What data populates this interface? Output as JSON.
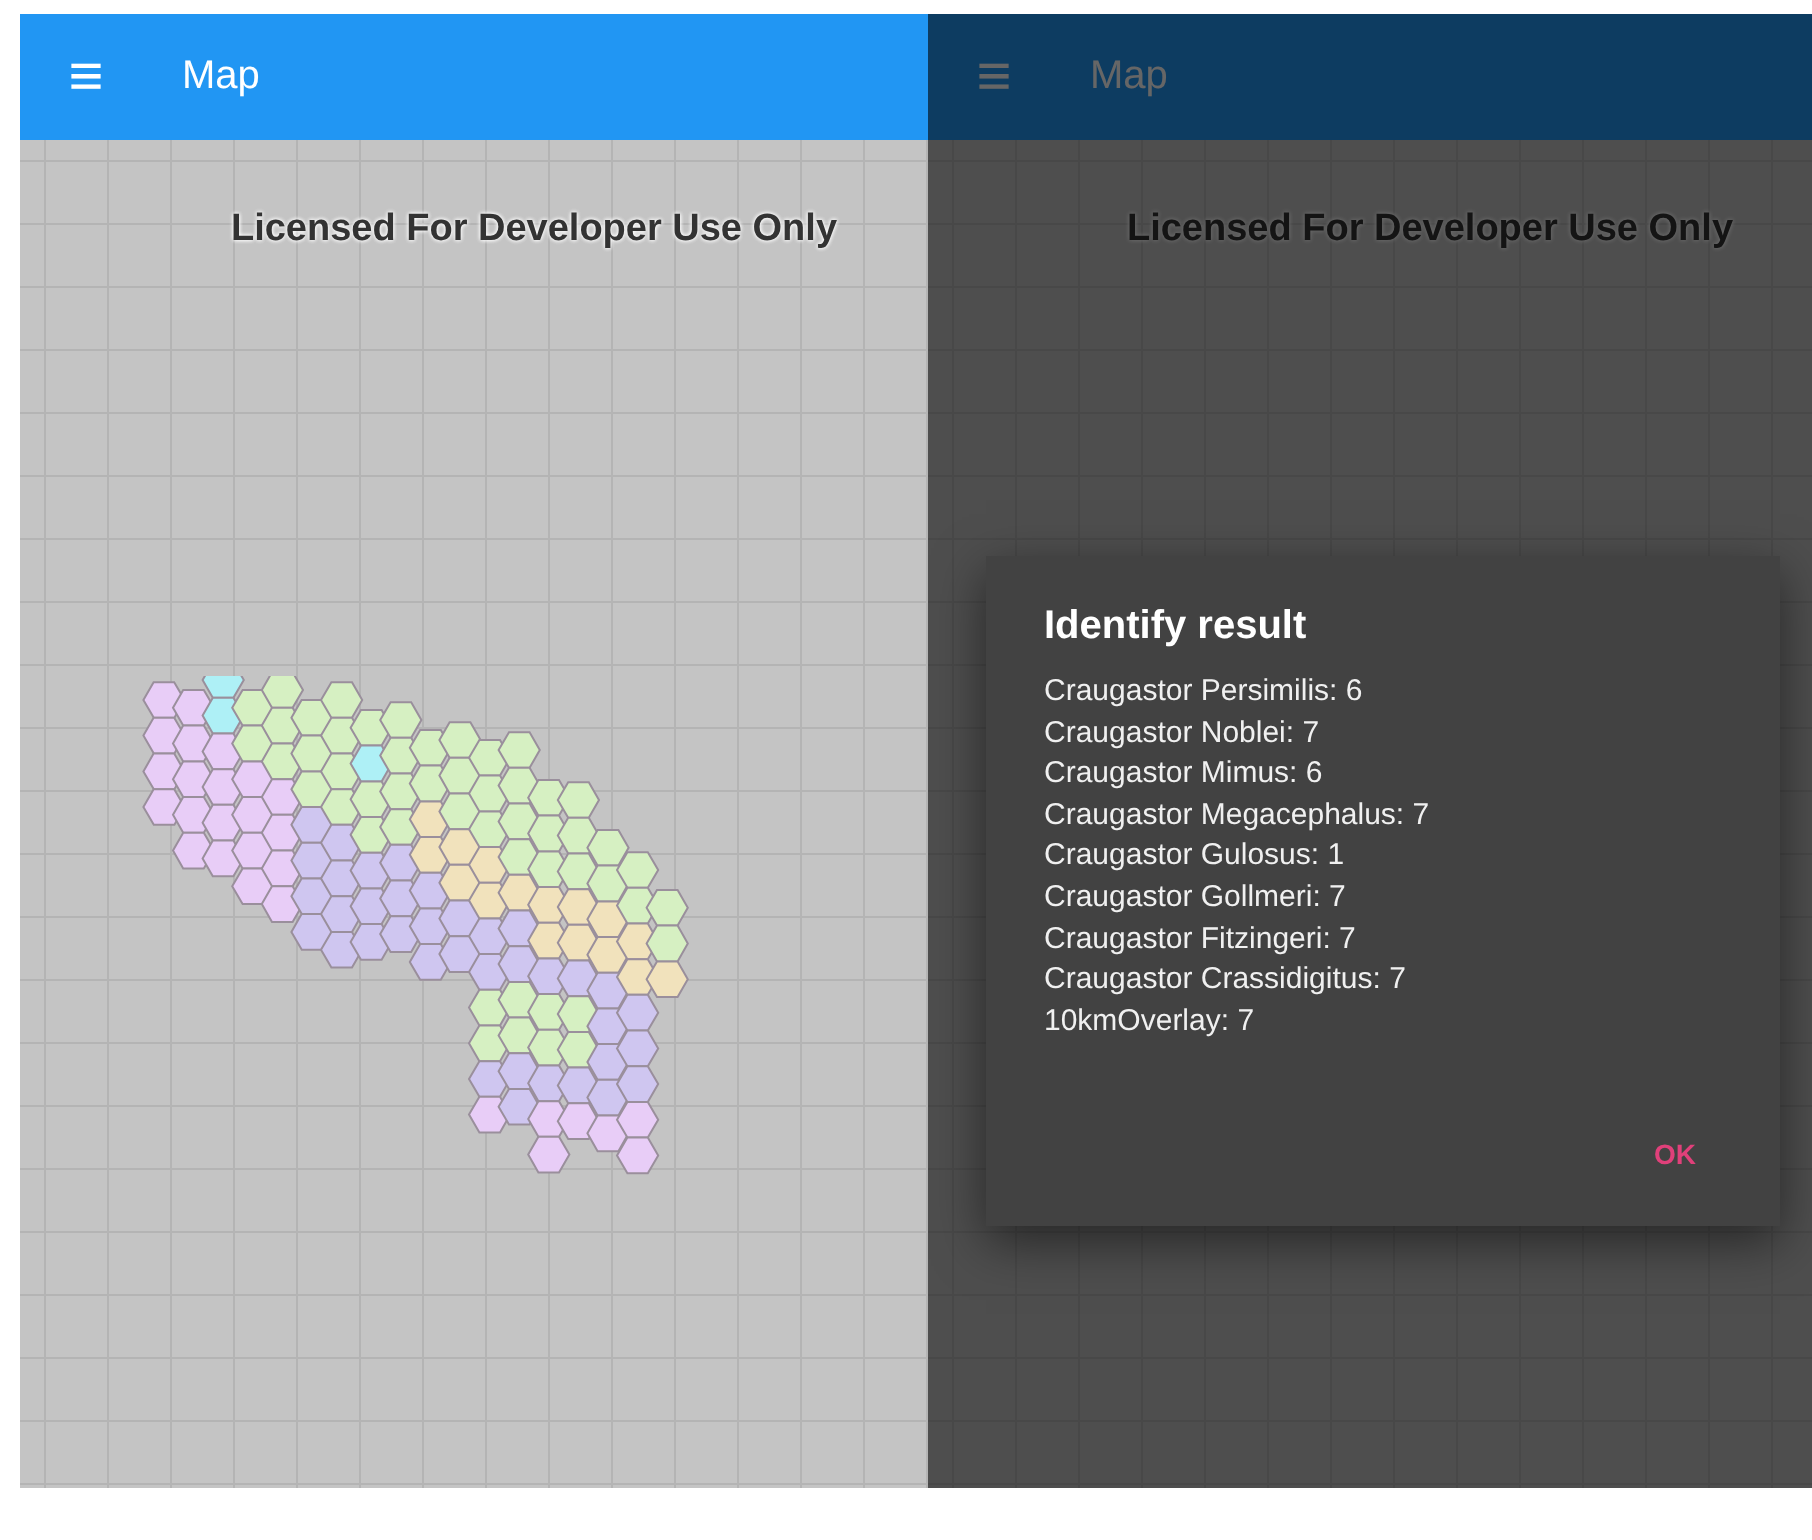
{
  "screens": [
    {
      "app_bar": {
        "menu_icon": "≡",
        "title": "Map"
      },
      "watermark": "Licensed For Developer Use Only",
      "hex_overlay": true,
      "dimmed": false
    },
    {
      "app_bar": {
        "menu_icon": "≡",
        "title": "Map"
      },
      "watermark": "Licensed For Developer Use Only",
      "hex_overlay": false,
      "dimmed": true,
      "dialog": {
        "title": "Identify result",
        "lines": [
          "Craugastor Persimilis: 6",
          "Craugastor Noblei: 7",
          "Craugastor Mimus: 6",
          "Craugastor Megacephalus: 7",
          "Craugastor Gulosus: 1",
          "Craugastor Gollmeri: 7",
          "Craugastor Fitzingeri: 7",
          "Craugastor Crassidigitus: 7",
          "10kmOverlay: 7"
        ],
        "button": "OK"
      }
    }
  ]
}
